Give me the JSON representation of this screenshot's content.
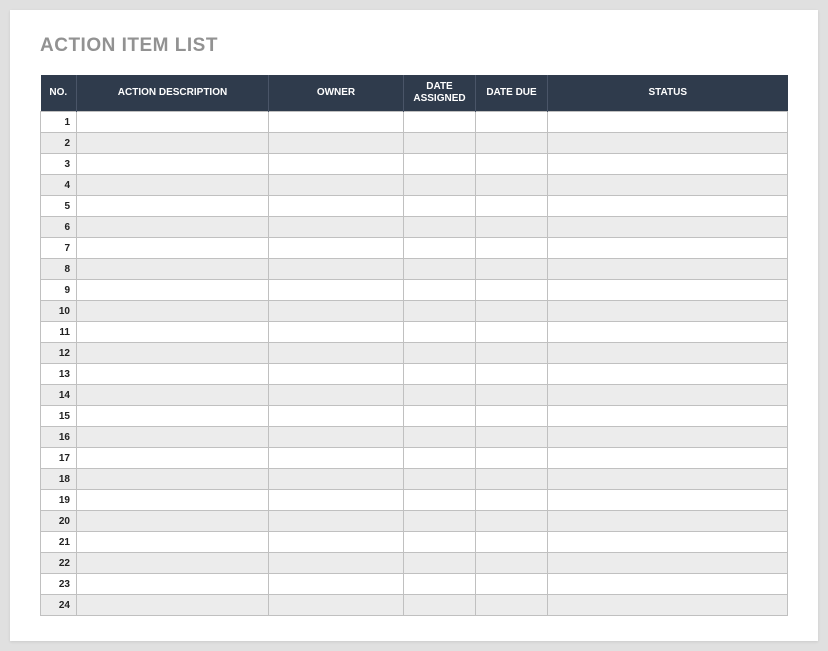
{
  "title": "ACTION ITEM LIST",
  "headers": {
    "no": "NO.",
    "description": "ACTION DESCRIPTION",
    "owner": "OWNER",
    "date_assigned": "DATE ASSIGNED",
    "date_due": "DATE DUE",
    "status": "STATUS"
  },
  "rows": [
    {
      "no": "1",
      "description": "",
      "owner": "",
      "date_assigned": "",
      "date_due": "",
      "status": ""
    },
    {
      "no": "2",
      "description": "",
      "owner": "",
      "date_assigned": "",
      "date_due": "",
      "status": ""
    },
    {
      "no": "3",
      "description": "",
      "owner": "",
      "date_assigned": "",
      "date_due": "",
      "status": ""
    },
    {
      "no": "4",
      "description": "",
      "owner": "",
      "date_assigned": "",
      "date_due": "",
      "status": ""
    },
    {
      "no": "5",
      "description": "",
      "owner": "",
      "date_assigned": "",
      "date_due": "",
      "status": ""
    },
    {
      "no": "6",
      "description": "",
      "owner": "",
      "date_assigned": "",
      "date_due": "",
      "status": ""
    },
    {
      "no": "7",
      "description": "",
      "owner": "",
      "date_assigned": "",
      "date_due": "",
      "status": ""
    },
    {
      "no": "8",
      "description": "",
      "owner": "",
      "date_assigned": "",
      "date_due": "",
      "status": ""
    },
    {
      "no": "9",
      "description": "",
      "owner": "",
      "date_assigned": "",
      "date_due": "",
      "status": ""
    },
    {
      "no": "10",
      "description": "",
      "owner": "",
      "date_assigned": "",
      "date_due": "",
      "status": ""
    },
    {
      "no": "11",
      "description": "",
      "owner": "",
      "date_assigned": "",
      "date_due": "",
      "status": ""
    },
    {
      "no": "12",
      "description": "",
      "owner": "",
      "date_assigned": "",
      "date_due": "",
      "status": ""
    },
    {
      "no": "13",
      "description": "",
      "owner": "",
      "date_assigned": "",
      "date_due": "",
      "status": ""
    },
    {
      "no": "14",
      "description": "",
      "owner": "",
      "date_assigned": "",
      "date_due": "",
      "status": ""
    },
    {
      "no": "15",
      "description": "",
      "owner": "",
      "date_assigned": "",
      "date_due": "",
      "status": ""
    },
    {
      "no": "16",
      "description": "",
      "owner": "",
      "date_assigned": "",
      "date_due": "",
      "status": ""
    },
    {
      "no": "17",
      "description": "",
      "owner": "",
      "date_assigned": "",
      "date_due": "",
      "status": ""
    },
    {
      "no": "18",
      "description": "",
      "owner": "",
      "date_assigned": "",
      "date_due": "",
      "status": ""
    },
    {
      "no": "19",
      "description": "",
      "owner": "",
      "date_assigned": "",
      "date_due": "",
      "status": ""
    },
    {
      "no": "20",
      "description": "",
      "owner": "",
      "date_assigned": "",
      "date_due": "",
      "status": ""
    },
    {
      "no": "21",
      "description": "",
      "owner": "",
      "date_assigned": "",
      "date_due": "",
      "status": ""
    },
    {
      "no": "22",
      "description": "",
      "owner": "",
      "date_assigned": "",
      "date_due": "",
      "status": ""
    },
    {
      "no": "23",
      "description": "",
      "owner": "",
      "date_assigned": "",
      "date_due": "",
      "status": ""
    },
    {
      "no": "24",
      "description": "",
      "owner": "",
      "date_assigned": "",
      "date_due": "",
      "status": ""
    }
  ]
}
